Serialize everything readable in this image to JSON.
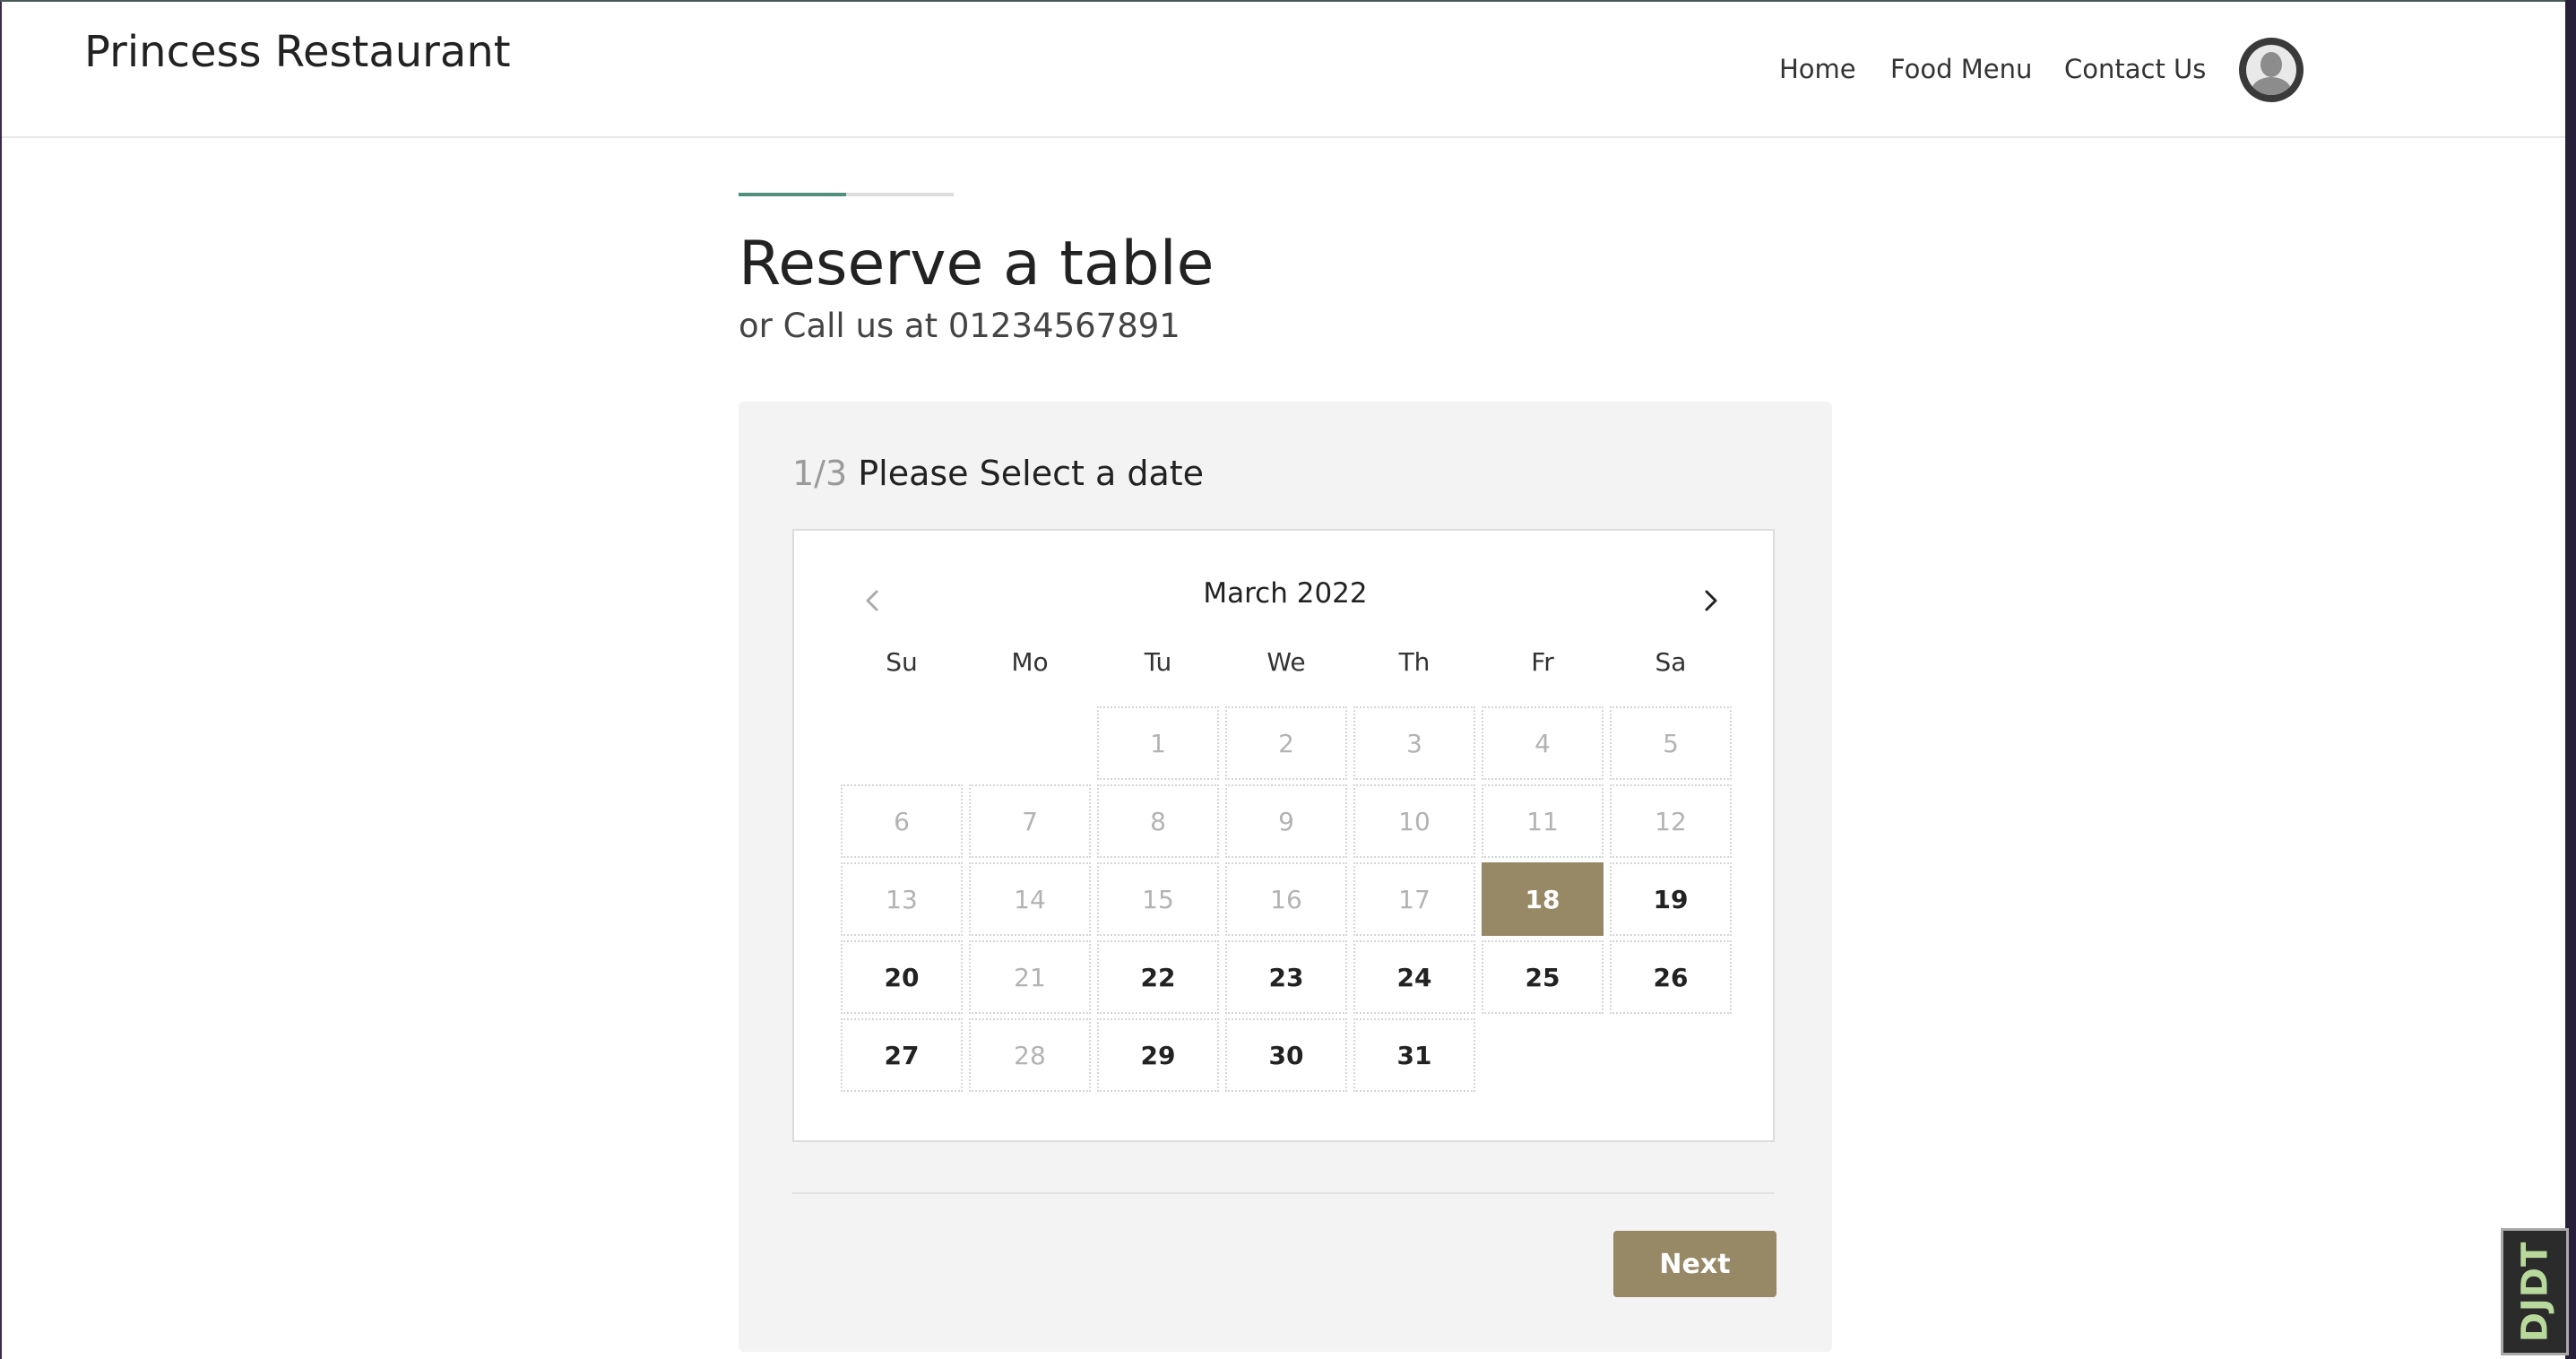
{
  "navbar": {
    "brand": "Princess Restaurant",
    "links": [
      {
        "label": "Home"
      },
      {
        "label": "Food Menu"
      },
      {
        "label": "Contact Us"
      }
    ],
    "avatar_icon": "user-avatar-icon"
  },
  "progress": {
    "step": 1,
    "total": 3,
    "fraction": 0.5,
    "color": "#4f8f7c"
  },
  "header": {
    "title": "Reserve a table",
    "subtitle": "or Call us at 01234567891"
  },
  "step": {
    "number": "1/3",
    "label": "Please Select a date"
  },
  "calendar": {
    "month_label": "March 2022",
    "prev_icon": "chevron-left-icon",
    "next_icon": "chevron-right-icon",
    "weekdays": [
      "Su",
      "Mo",
      "Tu",
      "We",
      "Th",
      "Fr",
      "Sa"
    ],
    "first_weekday_index": 2,
    "days": [
      {
        "day": "1",
        "state": "disabled"
      },
      {
        "day": "2",
        "state": "disabled"
      },
      {
        "day": "3",
        "state": "disabled"
      },
      {
        "day": "4",
        "state": "disabled"
      },
      {
        "day": "5",
        "state": "disabled"
      },
      {
        "day": "6",
        "state": "disabled"
      },
      {
        "day": "7",
        "state": "disabled"
      },
      {
        "day": "8",
        "state": "disabled"
      },
      {
        "day": "9",
        "state": "disabled"
      },
      {
        "day": "10",
        "state": "disabled"
      },
      {
        "day": "11",
        "state": "disabled"
      },
      {
        "day": "12",
        "state": "disabled"
      },
      {
        "day": "13",
        "state": "disabled"
      },
      {
        "day": "14",
        "state": "disabled"
      },
      {
        "day": "15",
        "state": "disabled"
      },
      {
        "day": "16",
        "state": "disabled"
      },
      {
        "day": "17",
        "state": "disabled"
      },
      {
        "day": "18",
        "state": "selected"
      },
      {
        "day": "19",
        "state": "available"
      },
      {
        "day": "20",
        "state": "available"
      },
      {
        "day": "21",
        "state": "disabled"
      },
      {
        "day": "22",
        "state": "available"
      },
      {
        "day": "23",
        "state": "available"
      },
      {
        "day": "24",
        "state": "available"
      },
      {
        "day": "25",
        "state": "available"
      },
      {
        "day": "26",
        "state": "available"
      },
      {
        "day": "27",
        "state": "available"
      },
      {
        "day": "28",
        "state": "disabled"
      },
      {
        "day": "29",
        "state": "available"
      },
      {
        "day": "30",
        "state": "available"
      },
      {
        "day": "31",
        "state": "available"
      }
    ],
    "selected_color": "#978866"
  },
  "actions": {
    "next_label": "Next"
  },
  "debug_toolbar": {
    "label": "DJDT"
  }
}
